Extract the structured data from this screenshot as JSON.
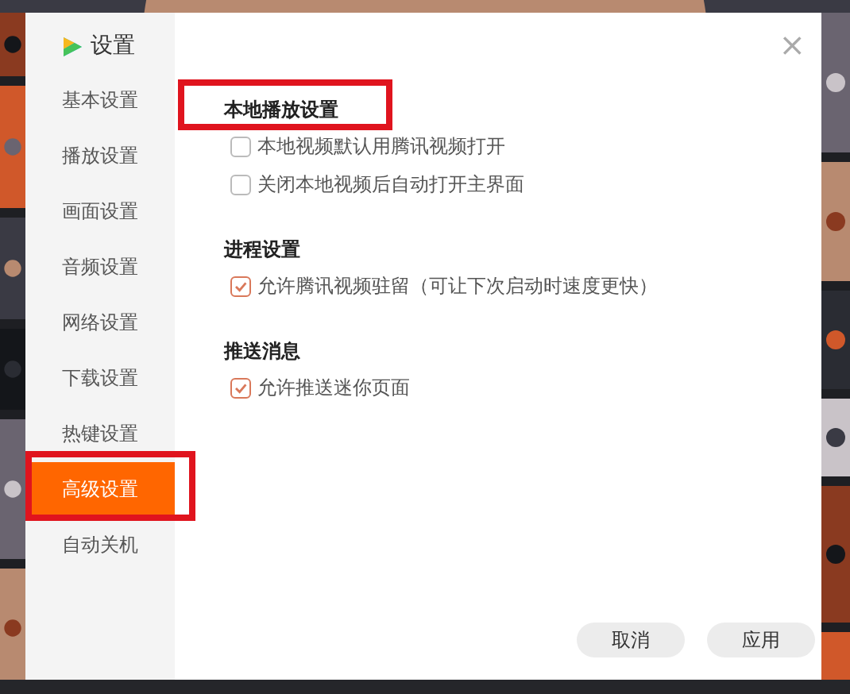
{
  "window": {
    "title": "设置",
    "close": "×"
  },
  "sidebar": {
    "items": [
      {
        "label": "基本设置",
        "selected": false,
        "annotated": false
      },
      {
        "label": "播放设置",
        "selected": false,
        "annotated": false
      },
      {
        "label": "画面设置",
        "selected": false,
        "annotated": false
      },
      {
        "label": "音频设置",
        "selected": false,
        "annotated": false
      },
      {
        "label": "网络设置",
        "selected": false,
        "annotated": false
      },
      {
        "label": "下载设置",
        "selected": false,
        "annotated": false
      },
      {
        "label": "热键设置",
        "selected": false,
        "annotated": false
      },
      {
        "label": "高级设置",
        "selected": true,
        "annotated": true
      },
      {
        "label": "自动关机",
        "selected": false,
        "annotated": false
      }
    ]
  },
  "sections": [
    {
      "title": "本地播放设置",
      "annotated": true,
      "options": [
        {
          "label": "本地视频默认用腾讯视频打开",
          "checked": false
        },
        {
          "label": "关闭本地视频后自动打开主界面",
          "checked": false
        }
      ]
    },
    {
      "title": "进程设置",
      "annotated": false,
      "options": [
        {
          "label": "允许腾讯视频驻留（可让下次启动时速度更快）",
          "checked": true
        }
      ]
    },
    {
      "title": "推送消息",
      "annotated": false,
      "options": [
        {
          "label": "允许推送迷你页面",
          "checked": true
        }
      ]
    }
  ],
  "buttons": [
    "取消",
    "应用"
  ]
}
